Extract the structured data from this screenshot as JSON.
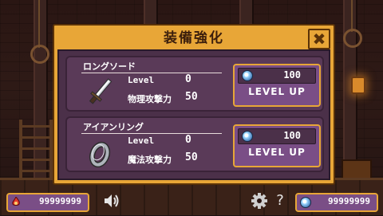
{
  "dialog": {
    "title": "装備強化",
    "close_label": "✖"
  },
  "items": [
    {
      "name": "ロングソード",
      "icon": "sword-icon",
      "level_label": "Level",
      "level_value": "0",
      "stat_label": "物理攻撃力",
      "stat_value": "50",
      "cost": "100",
      "upgrade_label": "LEVEL UP"
    },
    {
      "name": "アイアンリング",
      "icon": "ring-icon",
      "level_label": "Level",
      "level_value": "0",
      "stat_label": "魔法攻撃力",
      "stat_value": "50",
      "cost": "100",
      "upgrade_label": "LEVEL UP"
    }
  ],
  "hud": {
    "left_currency": {
      "icon": "soul-flame-icon",
      "value": "99999999"
    },
    "right_currency": {
      "icon": "gem-icon",
      "value": "99999999"
    },
    "sound_icon": "speaker-icon",
    "settings_icon": "gear-icon",
    "help_icon": "question-icon"
  },
  "colors": {
    "frame": "#e8a637",
    "panel": "#4b3049",
    "card": "#5a3a58",
    "button": "#7a4e86"
  }
}
